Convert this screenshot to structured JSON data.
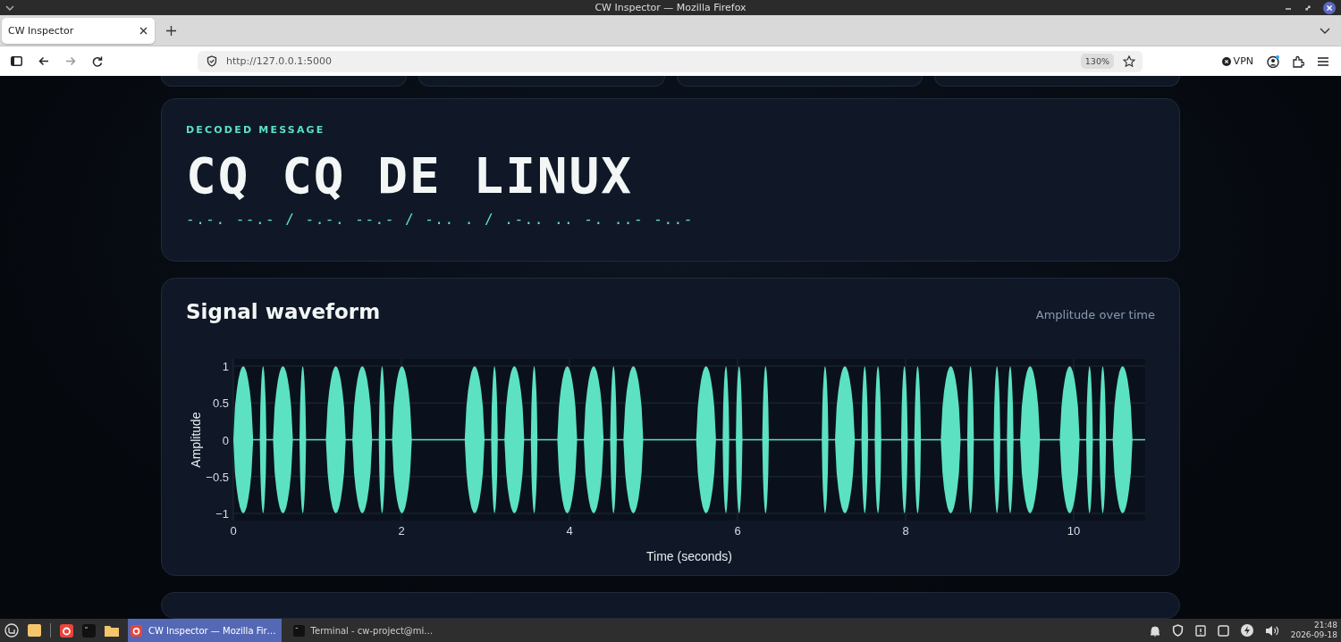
{
  "window": {
    "title": "CW Inspector — Mozilla Firefox"
  },
  "tabs": [
    {
      "label": "CW Inspector",
      "selected": true
    }
  ],
  "address_bar": {
    "url": "http://127.0.0.1:5000",
    "zoom": "130%"
  },
  "toolbar": {
    "vpn_label": "VPN"
  },
  "decoded": {
    "label": "DECODED MESSAGE",
    "message": "CQ CQ DE LINUX",
    "morse": "-.-. --.- / -.-. --.- / -.. . / .-.. .. -. ..- -..-"
  },
  "waveform": {
    "title": "Signal waveform",
    "subtitle": "Amplitude over time",
    "xlabel": "Time (seconds)",
    "ylabel": "Amplitude",
    "xticks": [
      "0",
      "2",
      "4",
      "6",
      "8",
      "10"
    ],
    "yticks": [
      "1",
      "0.5",
      "0",
      "−0.5",
      "−1"
    ]
  },
  "taskbar": {
    "windows": [
      {
        "label": "CW Inspector — Mozilla Fir…",
        "kind": "browser",
        "selected": true
      },
      {
        "label": "Terminal - cw-project@mi…",
        "kind": "terminal",
        "selected": false
      }
    ],
    "time": "21:48",
    "date": "2026-09-18"
  }
}
